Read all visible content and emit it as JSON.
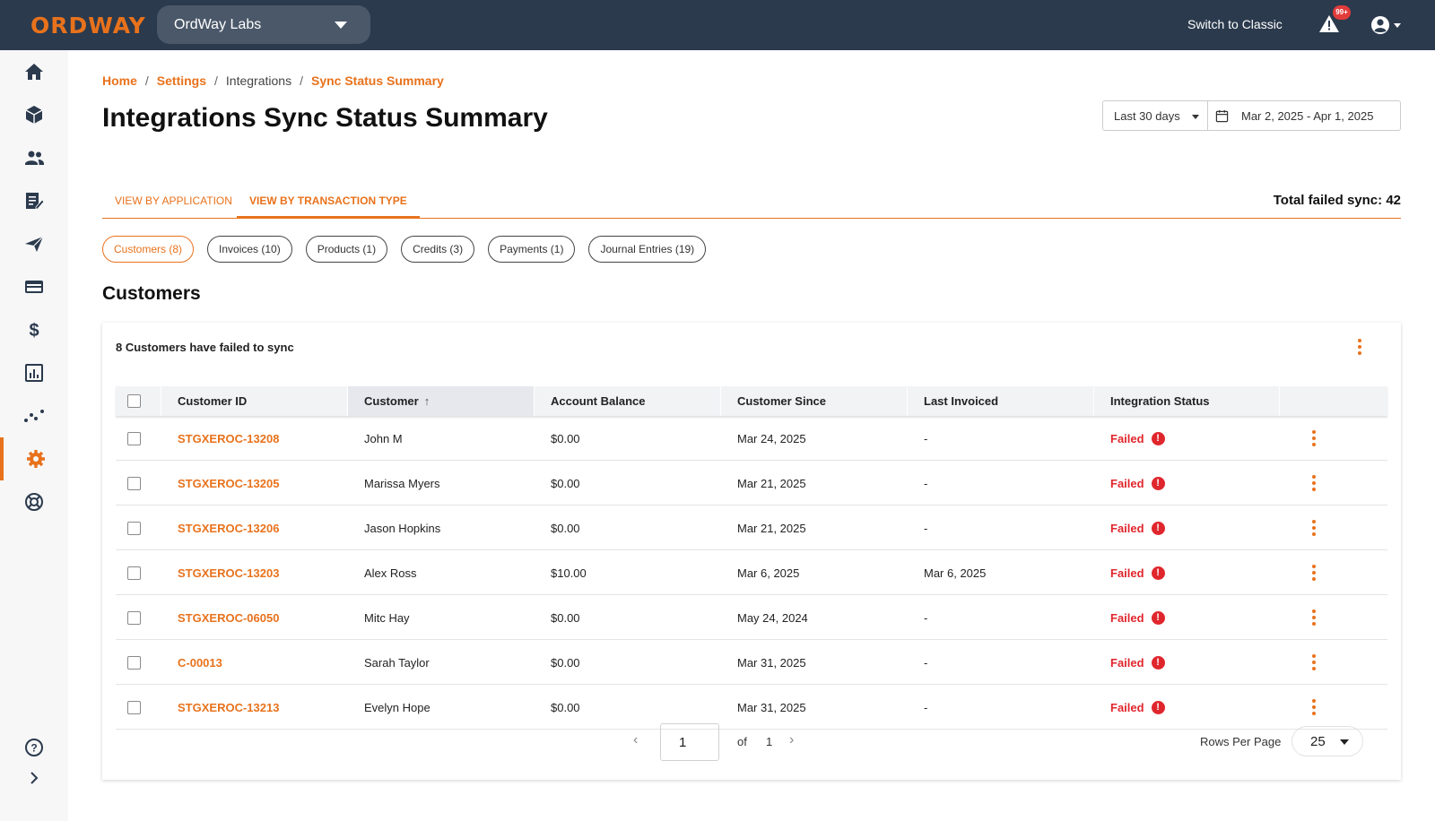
{
  "topbar": {
    "logo": "ORDWAY",
    "org_name": "OrdWay Labs",
    "switch_label": "Switch to Classic",
    "alert_badge": "99+"
  },
  "sidebar": {
    "items": [
      {
        "name": "home",
        "icon": "home-icon"
      },
      {
        "name": "products",
        "icon": "cube-icon"
      },
      {
        "name": "customers",
        "icon": "people-icon"
      },
      {
        "name": "billing",
        "icon": "document-edit-icon"
      },
      {
        "name": "send",
        "icon": "paper-plane-icon"
      },
      {
        "name": "payments",
        "icon": "credit-card-icon"
      },
      {
        "name": "revenue",
        "icon": "dollar-icon"
      },
      {
        "name": "reports",
        "icon": "bar-chart-icon"
      },
      {
        "name": "analytics",
        "icon": "trend-icon"
      },
      {
        "name": "settings",
        "icon": "gear-icon",
        "active": true
      },
      {
        "name": "support",
        "icon": "lifebuoy-icon"
      }
    ],
    "bottom": [
      {
        "name": "help",
        "icon": "help-icon"
      },
      {
        "name": "expand",
        "icon": "chevron-right-icon"
      }
    ]
  },
  "breadcrumb": {
    "home": "Home",
    "settings": "Settings",
    "integrations": "Integrations",
    "current": "Sync Status Summary",
    "sep": "/"
  },
  "page": {
    "title": "Integrations Sync Status Summary",
    "date_range": "Last 30 days",
    "date_value": "Mar 2, 2025 - Apr 1, 2025"
  },
  "tabs": {
    "by_application": "VIEW BY APPLICATION",
    "by_transaction": "VIEW BY TRANSACTION TYPE",
    "total_failed": "Total failed sync: 42"
  },
  "chips": [
    "Customers (8)",
    "Invoices (10)",
    "Products (1)",
    "Credits (3)",
    "Payments (1)",
    "Journal Entries (19)"
  ],
  "section": {
    "title": "Customers",
    "summary": "8 Customers have failed to sync"
  },
  "table": {
    "columns": [
      "Customer ID",
      "Customer",
      "Account Balance",
      "Customer Since",
      "Last Invoiced",
      "Integration Status"
    ],
    "sort_arrow": "↑",
    "rows": [
      {
        "id": "STGXEROC-13208",
        "customer": "John M",
        "balance": "$0.00",
        "since": "Mar 24, 2025",
        "last_invoiced": "-",
        "status": "Failed"
      },
      {
        "id": "STGXEROC-13205",
        "customer": "Marissa Myers",
        "balance": "$0.00",
        "since": "Mar 21, 2025",
        "last_invoiced": "-",
        "status": "Failed"
      },
      {
        "id": "STGXEROC-13206",
        "customer": "Jason Hopkins",
        "balance": "$0.00",
        "since": "Mar 21, 2025",
        "last_invoiced": "-",
        "status": "Failed"
      },
      {
        "id": "STGXEROC-13203",
        "customer": "Alex Ross",
        "balance": "$10.00",
        "since": "Mar 6, 2025",
        "last_invoiced": "Mar 6, 2025",
        "status": "Failed"
      },
      {
        "id": "STGXEROC-06050",
        "customer": "Mitc Hay",
        "balance": "$0.00",
        "since": "May 24, 2024",
        "last_invoiced": "-",
        "status": "Failed"
      },
      {
        "id": "C-00013",
        "customer": "Sarah Taylor",
        "balance": "$0.00",
        "since": "Mar 31, 2025",
        "last_invoiced": "-",
        "status": "Failed"
      },
      {
        "id": "STGXEROC-13213",
        "customer": "Evelyn Hope",
        "balance": "$0.00",
        "since": "Mar 31, 2025",
        "last_invoiced": "-",
        "status": "Failed"
      }
    ]
  },
  "pager": {
    "prev": "‹",
    "next": "›",
    "page": "1",
    "of_label": "of",
    "total_pages": "1",
    "rows_per_page_label": "Rows Per Page",
    "rows_per_page": "25"
  },
  "colors": {
    "accent": "#e8721c",
    "topbar": "#2b3a4d",
    "failed": "#e0262d"
  }
}
